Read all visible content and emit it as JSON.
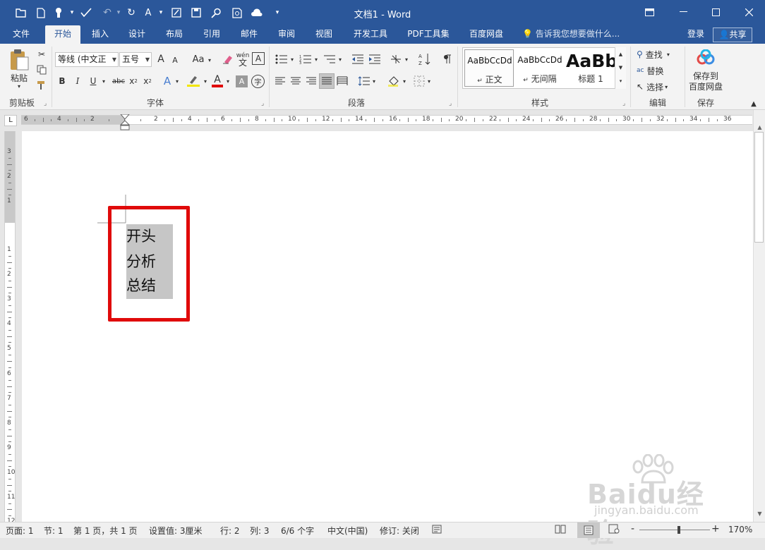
{
  "window": {
    "title": "文档1 - Word",
    "min_icon": "minimize-icon",
    "max_icon": "maximize-icon",
    "close_icon": "close-icon"
  },
  "tabs": [
    "文件",
    "开始",
    "插入",
    "设计",
    "布局",
    "引用",
    "邮件",
    "审阅",
    "视图",
    "开发工具",
    "PDF工具集",
    "百度网盘"
  ],
  "active_tab": "开始",
  "tell_me": "告诉我您想要做什么...",
  "login": "登录",
  "share": "共享",
  "clipboard": {
    "paste": "粘贴",
    "label": "剪贴板"
  },
  "font": {
    "name": "等线 (中文正",
    "size": "五号",
    "label": "字体",
    "grow": "A",
    "shrink": "A",
    "case": "Aa",
    "bold": "B",
    "italic": "I",
    "underline": "U",
    "strike": "abc",
    "sub": "x",
    "sup": "x",
    "effects": "A",
    "color": "A",
    "shade": "A",
    "phonetic": "wén",
    "phonetic_char": "文",
    "border": "A",
    "circle": "字"
  },
  "paragraph": {
    "label": "段落"
  },
  "styles": {
    "label": "样式",
    "items": [
      {
        "preview": "AaBbCcDd",
        "name": "正文"
      },
      {
        "preview": "AaBbCcDd",
        "name": "无间隔"
      },
      {
        "preview": "AaBb",
        "name": "标题 1"
      }
    ]
  },
  "editing": {
    "label": "编辑",
    "find": "查找",
    "replace": "替换",
    "select": "选择"
  },
  "save": {
    "label": "保存",
    "line1": "保存到",
    "line2": "百度网盘"
  },
  "hruler_numbers": [
    "6",
    "4",
    "2",
    "2",
    "4",
    "6",
    "8",
    "10",
    "12",
    "14",
    "16",
    "18",
    "20",
    "22",
    "24",
    "26",
    "28",
    "30",
    "32",
    "34",
    "36"
  ],
  "vruler_numbers": [
    "3",
    "2",
    "1",
    "1",
    "2",
    "3",
    "4",
    "5",
    "6",
    "7",
    "8",
    "9",
    "10",
    "11",
    "12"
  ],
  "ruler_corner": "L",
  "document": {
    "lines": [
      "开头",
      "分析",
      "总结"
    ]
  },
  "status": {
    "page": "页面: 1",
    "section": "节: 1",
    "pages": "第 1 页，共 1 页",
    "position": "设置值: 3厘米",
    "row": "行: 2",
    "col": "列: 3",
    "words": "6/6 个字",
    "lang": "中文(中国)",
    "track": "修订: 关闭",
    "zoom": "170%",
    "zoom_minus": "-",
    "zoom_plus": "+"
  },
  "watermark": {
    "text": "Baidu经验",
    "url": "jingyan.baidu.com"
  },
  "colors": {
    "title_bar": "#2b579a",
    "highlight": "#c6c6c6",
    "annotation": "#e00a0a"
  }
}
